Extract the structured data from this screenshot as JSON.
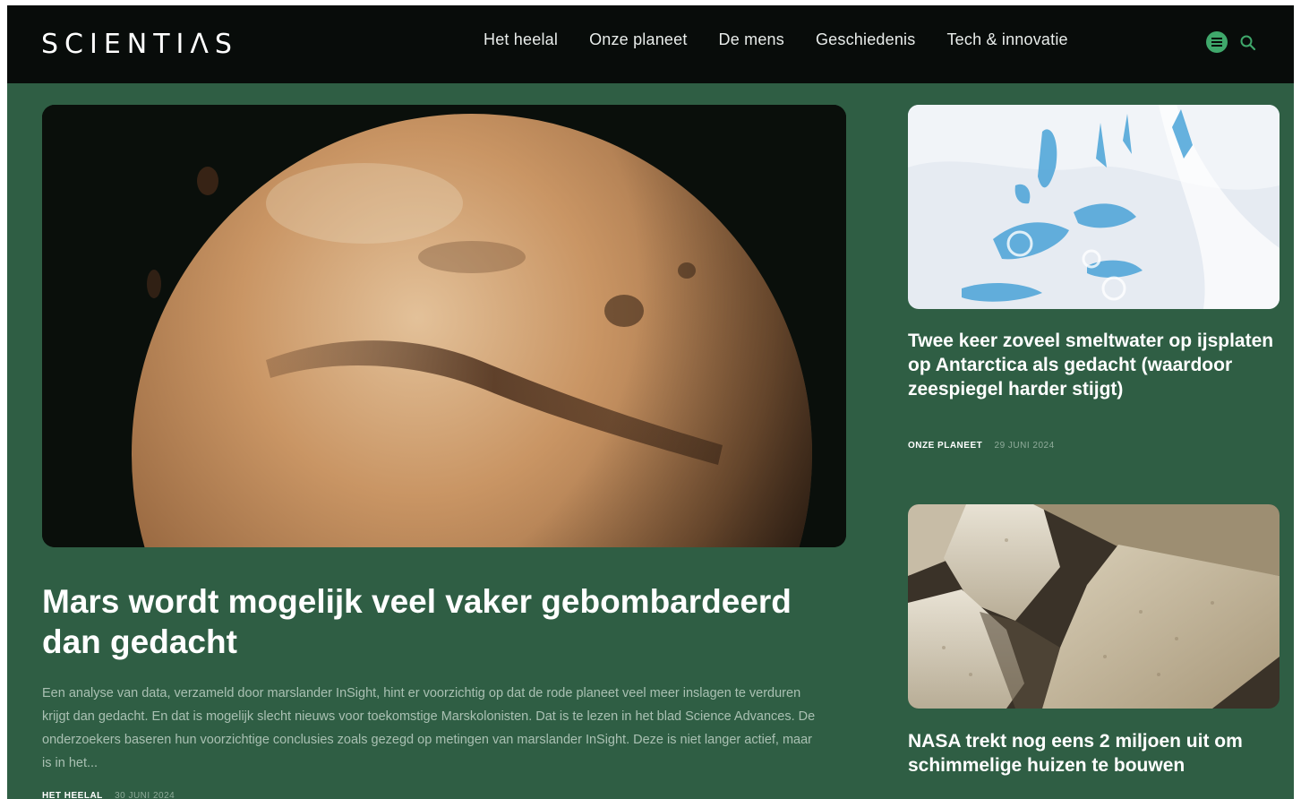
{
  "brand": {
    "logo": "SCIENTIΛS"
  },
  "nav": {
    "items": [
      "Het heelal",
      "Onze planeet",
      "De mens",
      "Geschiedenis",
      "Tech & innovatie"
    ]
  },
  "icons": {
    "menu": "menu-circle-icon",
    "search": "search-icon"
  },
  "colors": {
    "background": "#2f5e44",
    "header": "#080c0a",
    "accent": "#3fa86b"
  },
  "featured": {
    "title": "Mars wordt mogelijk veel vaker gebombardeerd dan gedacht",
    "excerpt": "Een analyse van data, verzameld door marslander InSight, hint er voorzichtig op dat de rode planeet veel meer inslagen te verduren krijgt dan gedacht. En dat is mogelijk slecht nieuws voor toekomstige Marskolonisten. Dat is te lezen in het blad Science Advances. De onderzoekers baseren hun voorzichtige conclusies zoals gezegd op metingen van marslander InSight. Deze is niet langer actief, maar is in het...",
    "category": "HET HEELAL",
    "date": "30 JUNI 2024"
  },
  "side_articles": [
    {
      "title": "Twee keer zoveel smeltwater op ijsplaten op Antarctica als gedacht (waardoor zeespiegel harder stijgt)",
      "category": "ONZE PLANEET",
      "date": "29 JUNI 2024"
    },
    {
      "title": "NASA trekt nog eens 2 miljoen uit om schimmelige huizen te bouwen"
    }
  ]
}
